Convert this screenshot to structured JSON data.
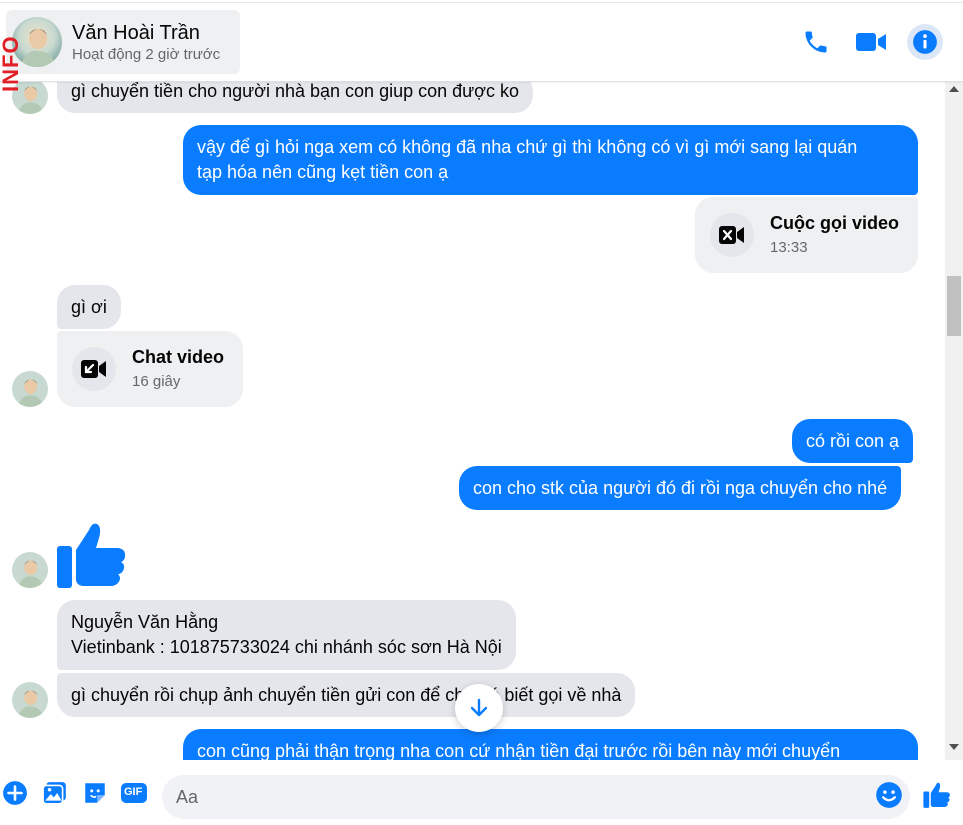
{
  "header": {
    "watermark": "INFO",
    "contact_name": "Văn Hoài Trần",
    "status": "Hoạt động 2 giờ trước",
    "call_icon": "phone-icon",
    "video_icon": "video-camera-icon",
    "info_icon": "info-icon"
  },
  "messages": {
    "m1": "gì chuyển tiền cho người nhà bạn con giup con được ko",
    "m2_line1": "vậy để gì hỏi nga xem có không đã nha chứ gì thì không có vì gì mới sang lại quán",
    "m2_line2": "tạp hóa nên cũng kẹt tiền con ạ",
    "call1_title": "Cuộc gọi video",
    "call1_time": "13:33",
    "m3": "gì ơi",
    "call2_title": "Chat video",
    "call2_duration": "16 giây",
    "m4": "có rồi con ạ",
    "m5": "con cho stk của người đó đi rồi nga chuyển cho nhé",
    "like_icon": "thumbs-up-icon",
    "m6_line1": "Nguyễn Văn Hằng",
    "m6_line2": "Vietinbank : 101875733024 chi nhánh sóc sơn Hà Nội",
    "m7": "gì chuyển rồi chụp ảnh chuyển tiền gửi con để cho nó biết gọi về nhà",
    "m8": "con cũng phải thận trọng nha con cứ nhận tiền đại trước rồi bên này mới chuyển"
  },
  "composer": {
    "placeholder": "Aa",
    "icons": [
      "plus-icon",
      "image-icon",
      "sticker-icon",
      "gif-icon",
      "emoji-icon",
      "like-icon"
    ],
    "gif_label": "GIF"
  },
  "colors": {
    "accent": "#0a7cff",
    "incoming_bubble": "#e4e6eb",
    "watermark": "#e21f26"
  }
}
